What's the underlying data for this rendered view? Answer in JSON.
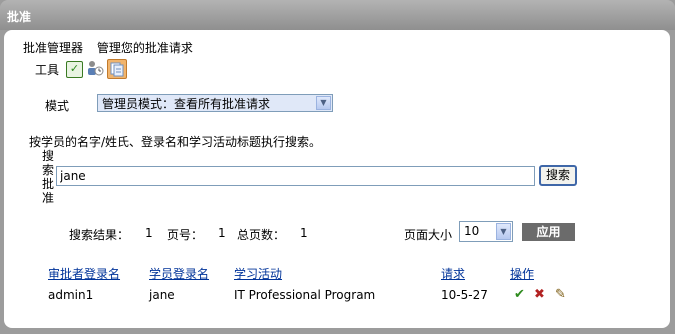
{
  "window": {
    "title": "批准"
  },
  "breadcrumb": {
    "app": "批准管理器",
    "current": "管理您的批准请求"
  },
  "tools": {
    "label": "工具",
    "icons": [
      "approve-icon",
      "users-icon",
      "documents-icon"
    ]
  },
  "mode": {
    "label": "模式",
    "selected": "管理员模式：查看所有批准请求"
  },
  "search": {
    "hint": "按学员的名字/姓氏、登录名和学习活动标题执行搜索。",
    "vertical_label": "搜索批准",
    "value": "jane",
    "button_label": "搜索"
  },
  "results": {
    "results_label": "搜索结果：",
    "results_count": "1",
    "page_label": "页号：",
    "page_number": "1",
    "total_pages_label": "总页数：",
    "total_pages": "1",
    "page_size_label": "页面大小",
    "page_size": "10",
    "apply_label": "应用"
  },
  "table": {
    "columns": [
      "审批者登录名",
      "学员登录名",
      "学习活动",
      "请求",
      "操作"
    ],
    "rows": [
      {
        "approver": "admin1",
        "learner": "jane",
        "activity": "IT Professional Program",
        "request": "10-5-27"
      }
    ],
    "row_actions": [
      "approve-icon",
      "reject-icon",
      "edit-icon"
    ]
  },
  "colors": {
    "link": "#003399",
    "panel_bg": "#ffffff",
    "frame": "#9c9c9c",
    "approve": "#2e8b1e",
    "reject": "#b22222"
  }
}
